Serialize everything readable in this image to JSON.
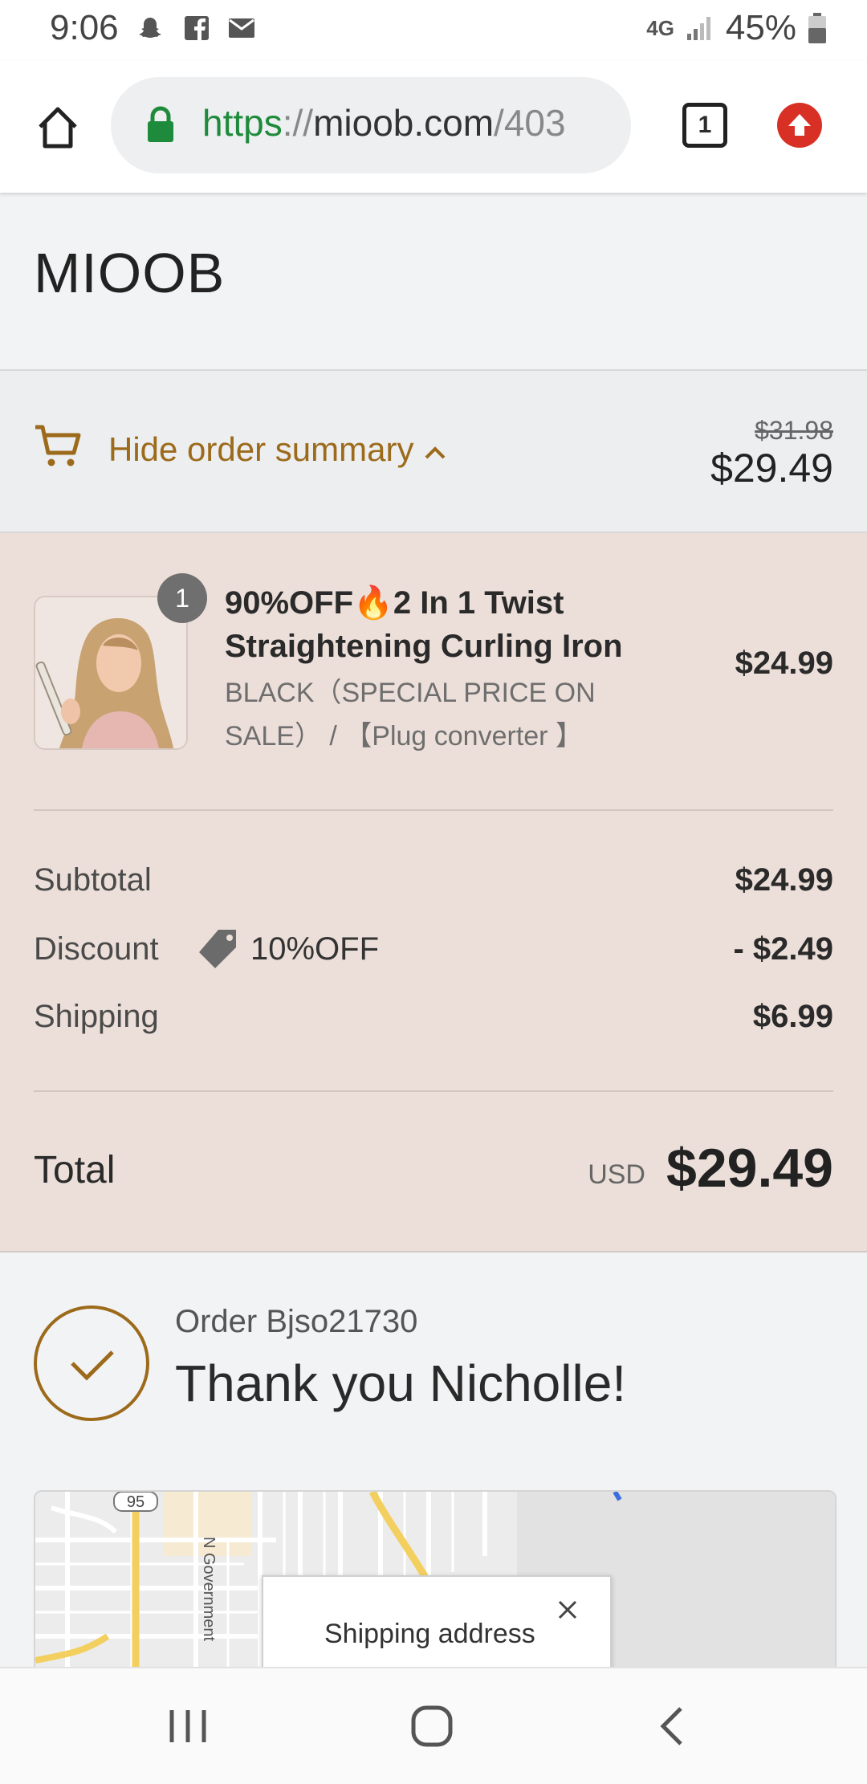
{
  "status_bar": {
    "time": "9:06",
    "network": "4G",
    "battery": "45%"
  },
  "browser": {
    "url_scheme": "https",
    "url_sep": "://",
    "url_host": "mioob.com",
    "url_path": "/403",
    "tab_count": "1"
  },
  "store": {
    "name": "MIOOB"
  },
  "summary_toggle": {
    "label": "Hide order summary",
    "original_price": "$31.98",
    "price": "$29.49"
  },
  "line_item": {
    "quantity": "1",
    "title": "90%OFF🔥2 In 1 Twist Straightening Curling Iron",
    "variant": "BLACK（SPECIAL PRICE ON SALE） / 【Plug converter 】",
    "price": "$24.99"
  },
  "totals": {
    "subtotal_label": "Subtotal",
    "subtotal_value": "$24.99",
    "discount_label": "Discount",
    "discount_code": "10%OFF",
    "discount_value": "- $2.49",
    "shipping_label": "Shipping",
    "shipping_value": "$6.99",
    "total_label": "Total",
    "currency": "USD",
    "total_value": "$29.49"
  },
  "confirmation": {
    "order_number": "Order Bjso21730",
    "thanks": "Thank you Nicholle!"
  },
  "map": {
    "route_label": "95",
    "street_label": "N Government",
    "popup_label": "Shipping address"
  },
  "colors": {
    "accent": "#9c6a1a",
    "panel": "#ecdfd9",
    "url_green": "#1e8b3c",
    "update_red": "#d93025"
  }
}
